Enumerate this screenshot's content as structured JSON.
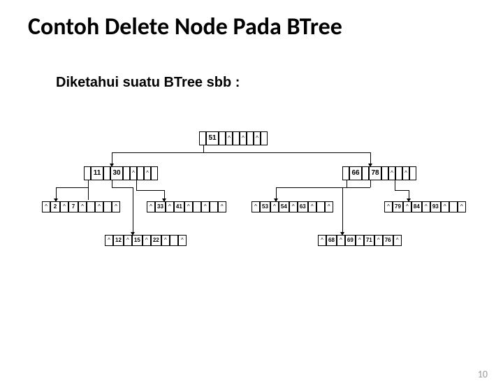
{
  "title": "Contoh Delete Node Pada BTree",
  "subtitle": "Diketahui suatu BTree sbb :",
  "pagenum": "10",
  "ptr": "^",
  "root": {
    "k1": "51"
  },
  "lv1": {
    "left": {
      "k1": "11",
      "k2": "30"
    },
    "right": {
      "k1": "66",
      "k2": "78"
    }
  },
  "lv2": {
    "a": {
      "k1": "2",
      "k2": "7"
    },
    "b": {
      "k1": "33",
      "k2": "41"
    },
    "c": {
      "k1": "53",
      "k2": "54",
      "k3": "63"
    },
    "d": {
      "k1": "79",
      "k2": "84",
      "k3": "93"
    }
  },
  "lv3": {
    "e": {
      "k1": "12",
      "k2": "15",
      "k3": "22"
    },
    "f": {
      "k1": "68",
      "k2": "69",
      "k3": "71",
      "k4": "76"
    }
  }
}
